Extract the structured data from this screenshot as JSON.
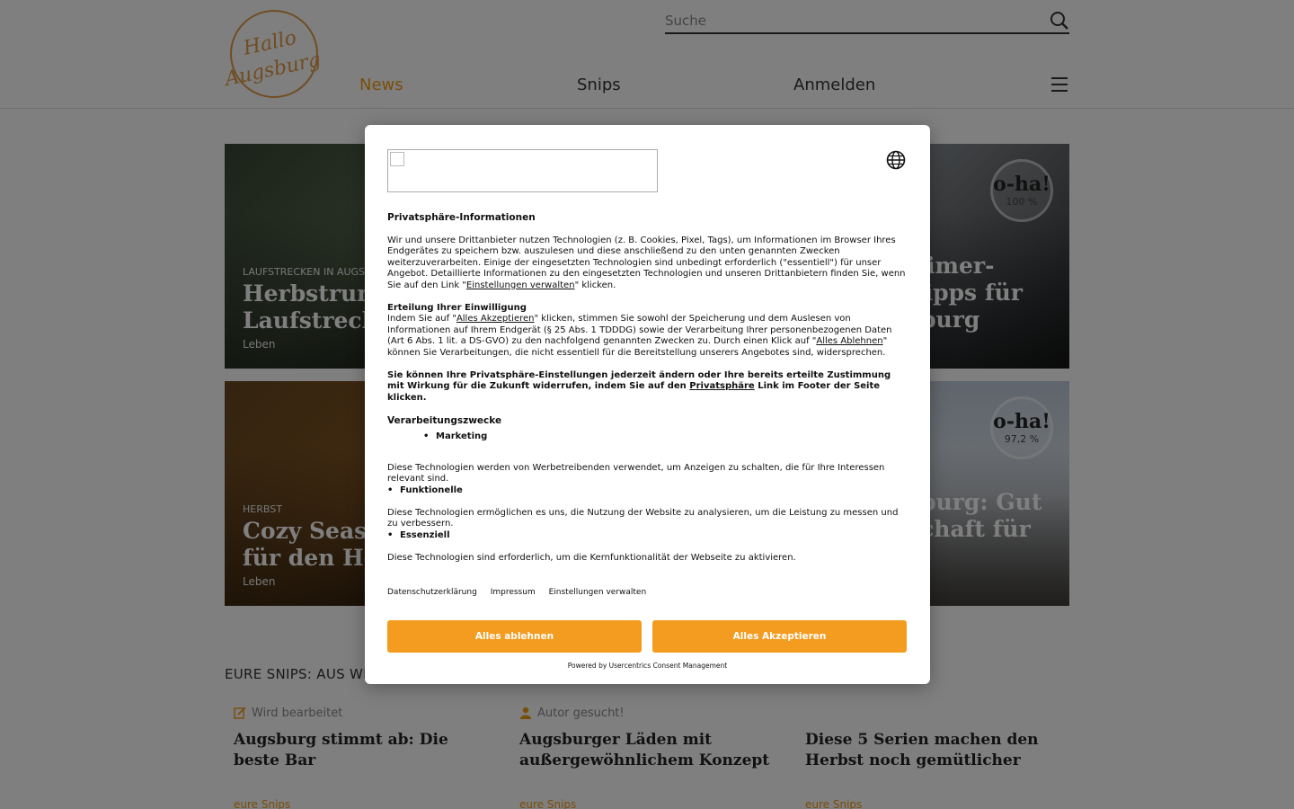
{
  "header": {
    "logo_text_line1": "Hallo",
    "logo_text_line2": "Augsburg",
    "search_placeholder": "Suche",
    "nav": [
      "News",
      "Snips",
      "Anmelden"
    ],
    "accent_color": "#f39c12"
  },
  "cards": [
    {
      "kicker": "LAUFSTRECKEN IN AUGSB",
      "title_line1": "Herbstrun i",
      "title_line2": "Laufstrecke",
      "category": "Leben"
    },
    {
      "title_line1": "ltimer-",
      "title_line2": "Tipps für",
      "title_line3": "sburg",
      "badge_label": "o-ha!",
      "badge_value": "100 %"
    },
    {
      "kicker": "HERBST",
      "title_line1": "Cozy Season",
      "title_line2": "für den Her",
      "category": "Leben"
    },
    {
      "title_line1": "sburg: Gut",
      "title_line2": "schaft für",
      "badge_label": "o-ha!",
      "badge_value": "97,2 %"
    }
  ],
  "snips": {
    "section_title": "EURE SNIPS: AUS WEI",
    "items": [
      {
        "status": "Wird bearbeitet",
        "title": "Augsburg stimmt ab: Die beste Bar",
        "status_icon": "edit-icon"
      },
      {
        "status": "Autor gesucht!",
        "title": "Augsburger Läden mit außergewöhnlichem Konzept",
        "status_icon": "user-icon"
      },
      {
        "status": "",
        "title": "Diese 5 Serien machen den Herbst noch gemütlicher"
      }
    ],
    "more_label": "eure Snips"
  },
  "consent": {
    "heading": "Privatsphäre-Informationen",
    "intro_1": "Wir und unsere Drittanbieter nutzen Technologien (z. B. Cookies, Pixel, Tags), um Informationen im Browser Ihres Endgerätes zu speichern bzw. auszulesen und diese anschließend zu den unten genannten Zwecken weiterzuverarbeiten. Einige der eingesetzten Technologien sind unbedingt erforderlich (\"essentiell\") für unser Angebot. Detaillierte Informationen zu den eingesetzten Technologien und unseren Drittanbietern finden Sie, wenn Sie auf den Link \"",
    "intro_link": "Einstellungen verwalten",
    "intro_2": "\" klicken.",
    "consent_heading": "Erteilung Ihrer Einwilligung",
    "consent_1": "Indem Sie auf \"",
    "consent_link_accept": "Alles Akzeptieren",
    "consent_2": "\" klicken, stimmen Sie sowohl der Speicherung und dem Auslesen von Informationen auf Ihrem Endgerät (§ 25 Abs. 1 TDDDG) sowie der Verarbeitung Ihrer personenbezogenen Daten (Art 6 Abs. 1 lit. a DS-GVO) zu den nachfolgend genannten Zwecken zu. Durch einen Klick auf \"",
    "consent_link_reject": "Alles Ablehnen",
    "consent_3": "\" können Sie  Verarbeitungen, die nicht essentiell für die Bereitstellung unserers Angebotes sind, widersprechen.",
    "revoke_1": "Sie können Ihre Privatsphäre-Einstellungen jederzeit ändern oder Ihre bereits erteilte Zustimmung mit Wirkung für die Zukunft widerrufen, indem Sie auf den ",
    "revoke_link": "Privatsphäre",
    "revoke_2": " Link im Footer der Seite klicken.",
    "purposes_heading": "Verarbeitungszwecke",
    "purpose_marketing": "Marketing",
    "marketing_desc": "Diese Technologien werden von Werbetreibenden verwendet, um Anzeigen zu schalten, die für Ihre Interessen relevant sind.",
    "purpose_functional": "Funktionelle",
    "functional_desc": "Diese Technologien ermöglichen es uns, die Nutzung der Website zu analysieren, um die Leistung zu messen und zu verbessern.",
    "purpose_essential": "Essenziell",
    "essential_desc": "Diese Technologien sind erforderlich, um die Kernfunktionalität der Webseite zu aktivieren.",
    "links": [
      "Datenschutzerklärung",
      "Impressum",
      "Einstellungen verwalten"
    ],
    "btn_reject": "Alles ablehnen",
    "btn_accept": "Alles Akzeptieren",
    "powered_by": "Powered by Usercentrics Consent Management",
    "button_color": "#f39c20"
  }
}
